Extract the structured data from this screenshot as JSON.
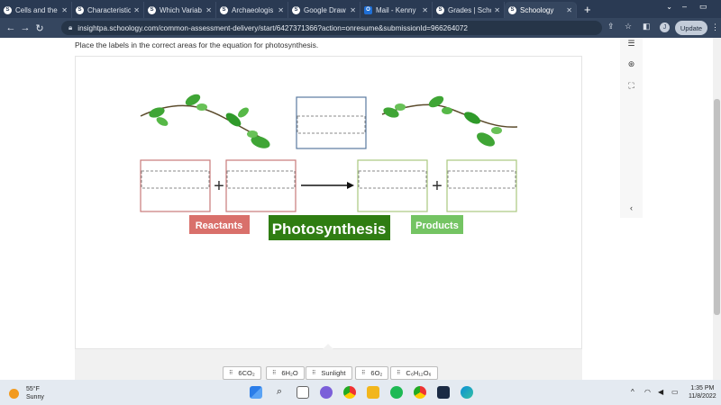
{
  "browser": {
    "tabs": [
      {
        "title": "Cells and the",
        "icon": "schoology-icon"
      },
      {
        "title": "Characteristic",
        "icon": "schoology-icon"
      },
      {
        "title": "Which Variab",
        "icon": "schoology-icon"
      },
      {
        "title": "Archaeologis",
        "icon": "schoology-icon"
      },
      {
        "title": "Google Draw",
        "icon": "schoology-icon"
      },
      {
        "title": "Mail - Kenny",
        "icon": "outlook-icon"
      },
      {
        "title": "Grades | Scho",
        "icon": "schoology-icon"
      },
      {
        "title": "Schoology",
        "icon": "schoology-icon"
      }
    ],
    "url": "insightpa.schoology.com/common-assessment-delivery/start/6427371366?action=onresume&submissionId=966264072",
    "avatar_initial": "J",
    "update_label": "Update"
  },
  "question": {
    "instruction": "Place the labels in the correct areas for the equation for photosynthesis.",
    "reactants_label": "Reactants",
    "products_label": "Products",
    "process_label": "Photosynthesis"
  },
  "answer_choices": [
    "6CO₂",
    "6H₂O",
    "Sunlight",
    "6O₂",
    "C₆H₁₂O₆"
  ],
  "colors": {
    "reactant_border": "#c97a7a",
    "product_border": "#a9c77f",
    "sunlight_border": "#5a7aa0",
    "reactants_bg": "#d9706b",
    "products_bg": "#74c463",
    "photosynthesis_bg": "#2f7d12"
  },
  "taskbar": {
    "weather_temp": "55°F",
    "weather_desc": "Sunny",
    "time": "1:35 PM",
    "date": "11/8/2022"
  }
}
